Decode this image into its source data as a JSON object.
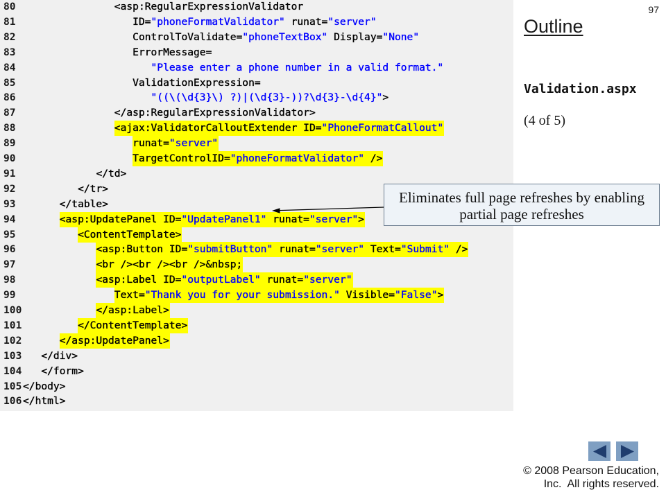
{
  "slide": {
    "page_number": "97",
    "outline_title": "Outline",
    "file_name": "Validation.aspx",
    "part_label": "(4 of 5)",
    "copyright": [
      "© 2008 Pearson Education,",
      "Inc.  All rights reserved."
    ]
  },
  "callout": {
    "lines": [
      "Eliminates full page refreshes by enabling",
      "partial page refreshes"
    ]
  },
  "nav": {
    "previous_icon": "triangle-left-icon",
    "next_icon": "triangle-right-icon"
  },
  "colors": {
    "code_panel": "#f0f0f0",
    "highlight": "#ffff00",
    "markup_text": "#000000",
    "attribute_value": "#0000ff",
    "line_number": "#1a1a1a",
    "callout_fill": "#eef3f8",
    "callout_border": "#6e7f92",
    "nav_button": "#7f9fc2",
    "nav_arrow": "#1f3d6e"
  },
  "code": {
    "lines": [
      {
        "num": "80",
        "text": "               <asp:RegularExpressionValidator",
        "highlight": false
      },
      {
        "num": "81",
        "text": "                  ID=\"phoneFormatValidator\" runat=\"server\"",
        "highlight": false
      },
      {
        "num": "82",
        "text": "                  ControlToValidate=\"phoneTextBox\" Display=\"None\"",
        "highlight": false
      },
      {
        "num": "83",
        "text": "                  ErrorMessage=",
        "highlight": false
      },
      {
        "num": "84",
        "text": "                     \"Please enter a phone number in a valid format.\"",
        "highlight": false
      },
      {
        "num": "85",
        "text": "                  ValidationExpression=",
        "highlight": false
      },
      {
        "num": "86",
        "text": "                     \"((\\(\\d{3}\\) ?)|(\\d{3}-))?\\d{3}-\\d{4}\">",
        "highlight": false
      },
      {
        "num": "87",
        "text": "               </asp:RegularExpressionValidator>",
        "highlight": false
      },
      {
        "num": "88",
        "text": "               <ajax:ValidatorCalloutExtender ID=\"PhoneFormatCallout\"",
        "highlight": true
      },
      {
        "num": "89",
        "text": "                  runat=\"server\"",
        "highlight": true
      },
      {
        "num": "90",
        "text": "                  TargetControlID=\"phoneFormatValidator\" />",
        "highlight": true
      },
      {
        "num": "91",
        "text": "            </td>",
        "highlight": false
      },
      {
        "num": "92",
        "text": "         </tr>",
        "highlight": false
      },
      {
        "num": "93",
        "text": "      </table>",
        "highlight": false
      },
      {
        "num": "94",
        "text": "      <asp:UpdatePanel ID=\"UpdatePanel1\" runat=\"server\">",
        "highlight": true
      },
      {
        "num": "95",
        "text": "         <ContentTemplate>",
        "highlight": true
      },
      {
        "num": "96",
        "text": "            <asp:Button ID=\"submitButton\" runat=\"server\" Text=\"Submit\" />",
        "highlight": true
      },
      {
        "num": "97",
        "text": "            <br /><br /><br />&nbsp;",
        "highlight": true
      },
      {
        "num": "98",
        "text": "            <asp:Label ID=\"outputLabel\" runat=\"server\"",
        "highlight": true
      },
      {
        "num": "99",
        "text": "               Text=\"Thank you for your submission.\" Visible=\"False\">",
        "highlight": true
      },
      {
        "num": "100",
        "text": "            </asp:Label>",
        "highlight": true
      },
      {
        "num": "101",
        "text": "         </ContentTemplate>",
        "highlight": true
      },
      {
        "num": "102",
        "text": "      </asp:UpdatePanel>",
        "highlight": true
      },
      {
        "num": "103",
        "text": "   </div>",
        "highlight": false
      },
      {
        "num": "104",
        "text": "   </form>",
        "highlight": false
      },
      {
        "num": "105",
        "text": "</body>",
        "highlight": false
      },
      {
        "num": "106",
        "text": "</html>",
        "highlight": false
      }
    ]
  }
}
